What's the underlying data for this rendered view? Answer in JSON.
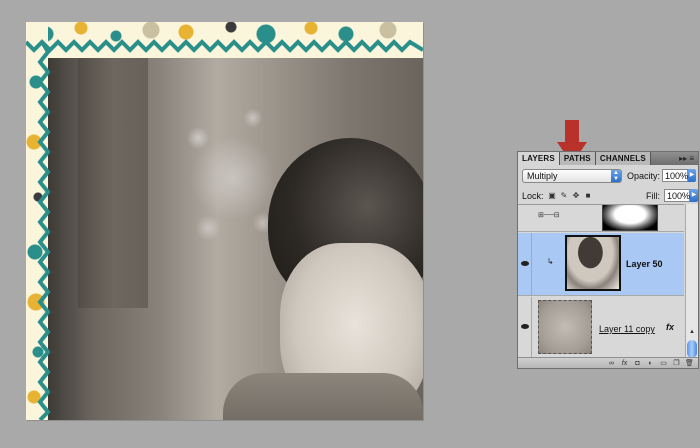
{
  "panel": {
    "tabs": [
      "LAYERS",
      "PATHS",
      "CHANNELS"
    ],
    "menu_glyph": "▸▸ ≡",
    "blend_mode": "Multiply",
    "opacity_label": "Opacity:",
    "opacity_value": "100%",
    "lock_label": "Lock:",
    "fill_label": "Fill:",
    "fill_value": "100%",
    "layers": [
      {
        "name": "Layer 50",
        "selected": true
      },
      {
        "name": "Layer 11 copy",
        "selected": false
      }
    ],
    "fx_label": "fx",
    "bottom_icons": [
      "link-icon",
      "fx-icon",
      "mask-icon",
      "adjustment-icon",
      "group-icon",
      "new-layer-icon",
      "trash-icon"
    ]
  },
  "colors": {
    "accent_arrow": "#b8312a",
    "selected_row": "#a9c8f4",
    "teal_zigzag": "#2a8f8b"
  }
}
